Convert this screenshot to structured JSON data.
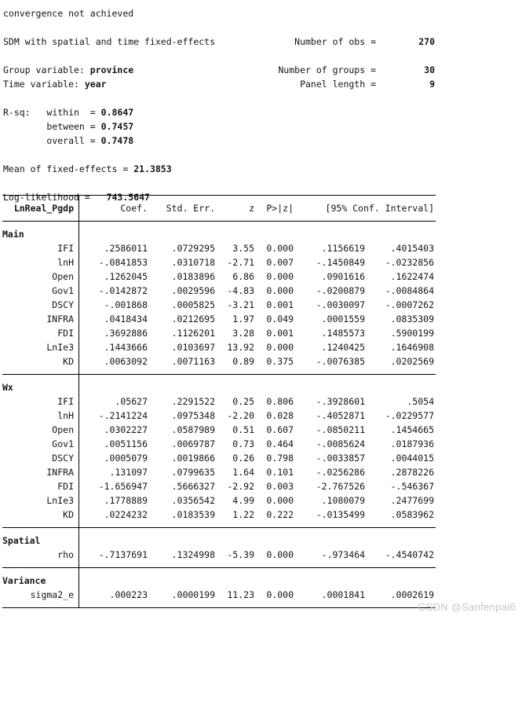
{
  "header": {
    "convergence_msg": "convergence not achieved",
    "model_title": "SDM with spatial and time fixed-effects",
    "group_variable_label": "Group variable: ",
    "group_variable_value": "province",
    "time_variable_label": "Time variable: ",
    "time_variable_value": "year",
    "stats": {
      "obs_label": "Number of obs =",
      "obs_value": "270",
      "groups_label": "Number of groups =",
      "groups_value": "30",
      "panel_label": "Panel length =",
      "panel_value": "9"
    },
    "rsq": {
      "title": "R-sq:",
      "within_label": "within  =",
      "within_value": "0.8647",
      "between_label": "between =",
      "between_value": "0.7457",
      "overall_label": "overall =",
      "overall_value": "0.7478"
    },
    "mean_fe_label": "Mean of fixed-effects =",
    "mean_fe_value": "21.3853",
    "loglik_label": "Log-likelihood =",
    "loglik_value": "743.5647"
  },
  "table": {
    "columns": {
      "depvar": "LnReal_Pgdp",
      "coef": "Coef.",
      "std_err": "Std. Err.",
      "z": "z",
      "p": "P>|z|",
      "ci": "[95% Conf. Interval]"
    },
    "sections": [
      {
        "name": "Main",
        "rows": [
          {
            "var": "IFI",
            "coef": ".2586011",
            "se": ".0729295",
            "z": "3.55",
            "p": "0.000",
            "ci_lo": ".1156619",
            "ci_hi": ".4015403"
          },
          {
            "var": "lnH",
            "coef": "-.0841853",
            "se": ".0310718",
            "z": "-2.71",
            "p": "0.007",
            "ci_lo": "-.1450849",
            "ci_hi": "-.0232856"
          },
          {
            "var": "Open",
            "coef": ".1262045",
            "se": ".0183896",
            "z": "6.86",
            "p": "0.000",
            "ci_lo": ".0901616",
            "ci_hi": ".1622474"
          },
          {
            "var": "Gov1",
            "coef": "-.0142872",
            "se": ".0029596",
            "z": "-4.83",
            "p": "0.000",
            "ci_lo": "-.0200879",
            "ci_hi": "-.0084864"
          },
          {
            "var": "DSCY",
            "coef": "-.001868",
            "se": ".0005825",
            "z": "-3.21",
            "p": "0.001",
            "ci_lo": "-.0030097",
            "ci_hi": "-.0007262"
          },
          {
            "var": "INFRA",
            "coef": ".0418434",
            "se": ".0212695",
            "z": "1.97",
            "p": "0.049",
            "ci_lo": ".0001559",
            "ci_hi": ".0835309"
          },
          {
            "var": "FDI",
            "coef": ".3692886",
            "se": ".1126201",
            "z": "3.28",
            "p": "0.001",
            "ci_lo": ".1485573",
            "ci_hi": ".5900199"
          },
          {
            "var": "LnIe3",
            "coef": ".1443666",
            "se": ".0103697",
            "z": "13.92",
            "p": "0.000",
            "ci_lo": ".1240425",
            "ci_hi": ".1646908"
          },
          {
            "var": "KD",
            "coef": ".0063092",
            "se": ".0071163",
            "z": "0.89",
            "p": "0.375",
            "ci_lo": "-.0076385",
            "ci_hi": ".0202569"
          }
        ]
      },
      {
        "name": "Wx",
        "rows": [
          {
            "var": "IFI",
            "coef": ".05627",
            "se": ".2291522",
            "z": "0.25",
            "p": "0.806",
            "ci_lo": "-.3928601",
            "ci_hi": ".5054"
          },
          {
            "var": "lnH",
            "coef": "-.2141224",
            "se": ".0975348",
            "z": "-2.20",
            "p": "0.028",
            "ci_lo": "-.4052871",
            "ci_hi": "-.0229577"
          },
          {
            "var": "Open",
            "coef": ".0302227",
            "se": ".0587989",
            "z": "0.51",
            "p": "0.607",
            "ci_lo": "-.0850211",
            "ci_hi": ".1454665"
          },
          {
            "var": "Gov1",
            "coef": ".0051156",
            "se": ".0069787",
            "z": "0.73",
            "p": "0.464",
            "ci_lo": "-.0085624",
            "ci_hi": ".0187936"
          },
          {
            "var": "DSCY",
            "coef": ".0005079",
            "se": ".0019866",
            "z": "0.26",
            "p": "0.798",
            "ci_lo": "-.0033857",
            "ci_hi": ".0044015"
          },
          {
            "var": "INFRA",
            "coef": ".131097",
            "se": ".0799635",
            "z": "1.64",
            "p": "0.101",
            "ci_lo": "-.0256286",
            "ci_hi": ".2878226"
          },
          {
            "var": "FDI",
            "coef": "-1.656947",
            "se": ".5666327",
            "z": "-2.92",
            "p": "0.003",
            "ci_lo": "-2.767526",
            "ci_hi": "-.546367"
          },
          {
            "var": "LnIe3",
            "coef": ".1778889",
            "se": ".0356542",
            "z": "4.99",
            "p": "0.000",
            "ci_lo": ".1080079",
            "ci_hi": ".2477699"
          },
          {
            "var": "KD",
            "coef": ".0224232",
            "se": ".0183539",
            "z": "1.22",
            "p": "0.222",
            "ci_lo": "-.0135499",
            "ci_hi": ".0583962"
          }
        ]
      },
      {
        "name": "Spatial",
        "rows": [
          {
            "var": "rho",
            "coef": "-.7137691",
            "se": ".1324998",
            "z": "-5.39",
            "p": "0.000",
            "ci_lo": "-.973464",
            "ci_hi": "-.4540742"
          }
        ]
      },
      {
        "name": "Variance",
        "rows": [
          {
            "var": "sigma2_e",
            "coef": ".000223",
            "se": ".0000199",
            "z": "11.23",
            "p": "0.000",
            "ci_lo": ".0001841",
            "ci_hi": ".0002619"
          }
        ]
      }
    ]
  },
  "watermark": "CSDN @Sanfenpai6"
}
